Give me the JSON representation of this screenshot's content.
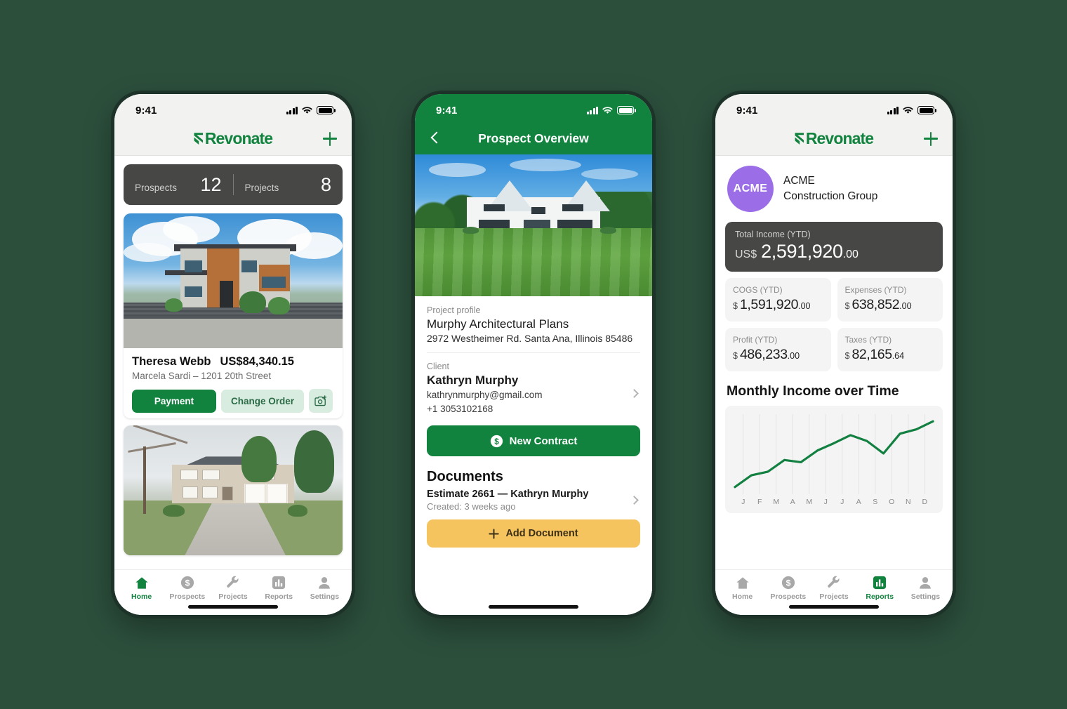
{
  "app": {
    "name": "Revonate",
    "accent_green": "#12833f",
    "background": "#2c4f3c",
    "dark_card": "#474746",
    "yellow": "#f5c45e",
    "avatar_purple": "#9b6ee8"
  },
  "status_bar": {
    "time": "9:41",
    "signal_icon": "cellular-bars-icon",
    "wifi_icon": "wifi-icon",
    "battery_icon": "battery-full-icon"
  },
  "nav_tabs": [
    {
      "id": "home",
      "label": "Home",
      "icon": "home-icon"
    },
    {
      "id": "prospects",
      "label": "Prospects",
      "icon": "dollar-circle-icon"
    },
    {
      "id": "projects",
      "label": "Projects",
      "icon": "wrench-icon"
    },
    {
      "id": "reports",
      "label": "Reports",
      "icon": "bar-chart-icon"
    },
    {
      "id": "settings",
      "label": "Settings",
      "icon": "person-icon"
    }
  ],
  "phone1": {
    "header": {
      "logo": "Revonate",
      "add_icon": "plus-icon"
    },
    "stats": [
      {
        "label": "Prospects",
        "value": "12"
      },
      {
        "label": "Projects",
        "value": "8"
      }
    ],
    "listings": [
      {
        "photo": "modern-two-story-house-photo",
        "name": "Theresa Webb",
        "amount": "US$84,340.15",
        "subtitle": "Marcela Sardi – 1201 20th Street",
        "buttons": {
          "payment": "Payment",
          "change_order": "Change Order",
          "camera_icon": "camera-add-icon"
        }
      },
      {
        "photo": "brick-colonial-house-photo"
      }
    ],
    "active_tab": "home"
  },
  "phone2": {
    "navbar": {
      "title": "Prospect Overview",
      "back_icon": "chevron-left-icon"
    },
    "hero_photo": "white-gabled-house-lawn-photo",
    "project": {
      "section_label": "Project profile",
      "title": "Murphy Architectural Plans",
      "address": "2972 Westheimer Rd. Santa Ana, Illinois 85486"
    },
    "client": {
      "section_label": "Client",
      "name": "Kathryn Murphy",
      "email": "kathrynmurphy@gmail.com",
      "phone": "+1 3053102168",
      "chevron_icon": "chevron-right-icon"
    },
    "new_contract_button": {
      "label": "New Contract",
      "icon": "dollar-circle-icon"
    },
    "documents": {
      "heading": "Documents",
      "items": [
        {
          "title": "Estimate 2661 — Kathryn Murphy",
          "meta": "Created: 3 weeks ago",
          "chevron_icon": "chevron-right-icon"
        }
      ],
      "add_button": {
        "label": "Add Document",
        "icon": "plus-icon"
      }
    }
  },
  "phone3": {
    "header": {
      "logo": "Revonate",
      "add_icon": "plus-icon"
    },
    "org": {
      "avatar_text": "ACME",
      "line1": "ACME",
      "line2": "Construction Group"
    },
    "total_income": {
      "label": "Total Income (YTD)",
      "currency": "US$",
      "amount": "2,591,920",
      "cents": ".00"
    },
    "kpis": [
      {
        "label": "COGS (YTD)",
        "currency": "$",
        "amount": "1,591,920",
        "cents": ".00"
      },
      {
        "label": "Expenses (YTD)",
        "currency": "$",
        "amount": "638,852",
        "cents": ".00"
      },
      {
        "label": "Profit (YTD)",
        "currency": "$",
        "amount": "486,233",
        "cents": ".00"
      },
      {
        "label": "Taxes (YTD)",
        "currency": "$",
        "amount": "82,165",
        "cents": ".64"
      }
    ],
    "chart_title": "Monthly Income over Time",
    "active_tab": "reports"
  },
  "chart_data": {
    "type": "line",
    "title": "Monthly Income over Time",
    "xlabel": "",
    "ylabel": "",
    "categories": [
      "J",
      "F",
      "M",
      "A",
      "M",
      "J",
      "J",
      "A",
      "S",
      "O",
      "N",
      "D"
    ],
    "series": [
      {
        "name": "Monthly Income",
        "color": "#128040",
        "values": [
          6,
          22,
          27,
          43,
          40,
          56,
          66,
          77,
          69,
          52,
          79,
          85,
          96
        ]
      }
    ],
    "values": [
      6,
      22,
      27,
      43,
      40,
      56,
      66,
      77,
      69,
      52,
      79,
      85,
      96
    ],
    "ylim": [
      0,
      100
    ],
    "grid": true,
    "grid_orientation": "vertical",
    "legend": "none",
    "line_color": "#128040"
  }
}
